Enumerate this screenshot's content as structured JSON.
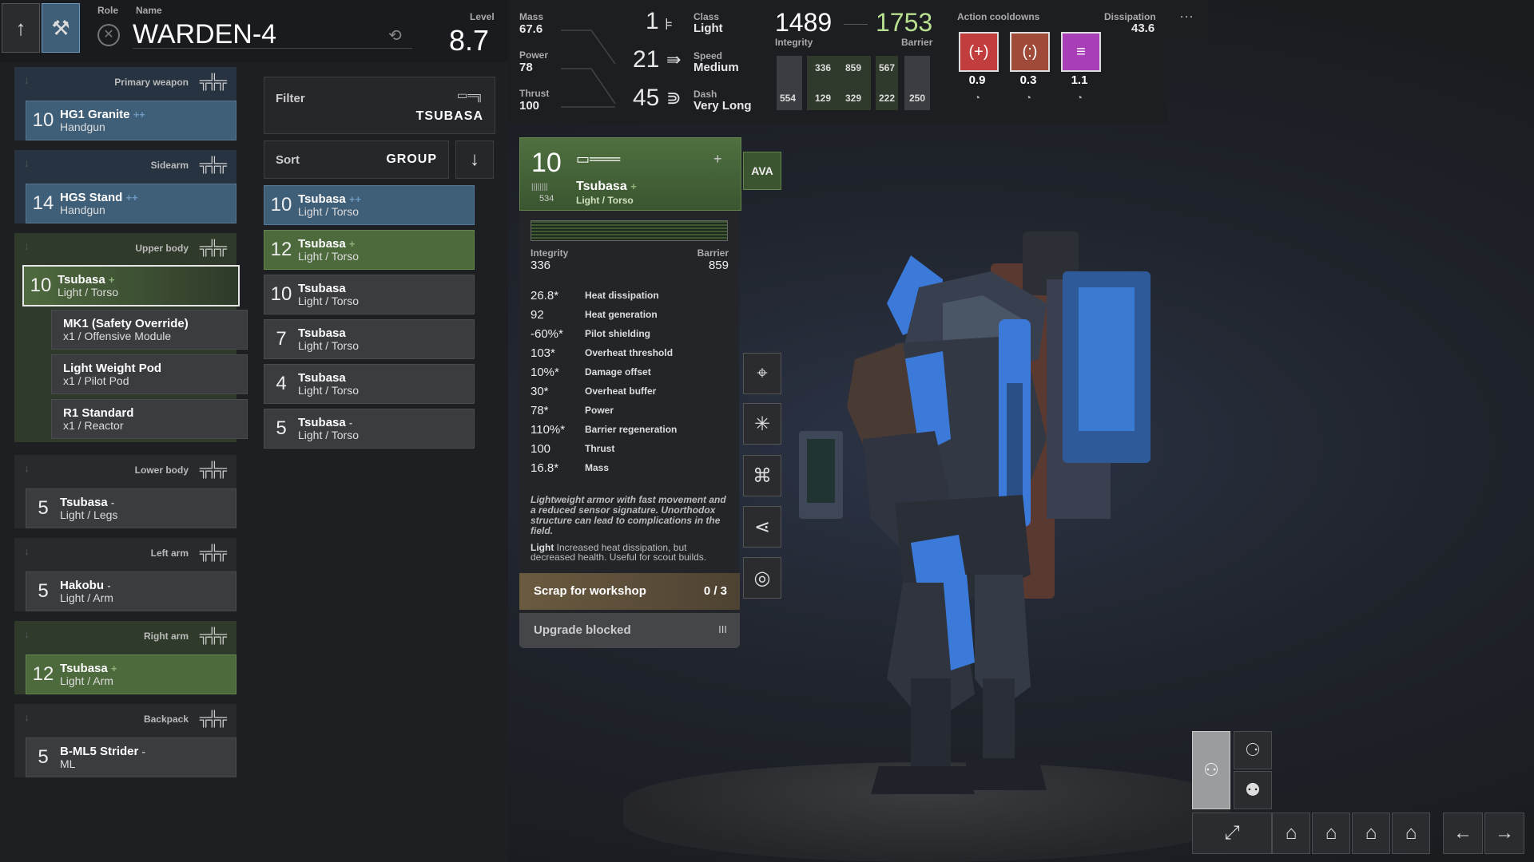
{
  "header": {
    "role_label": "Role",
    "name_label": "Name",
    "mech_name": "WARDEN-4",
    "level_label": "Level",
    "level": "8.7"
  },
  "top_stats": {
    "mass_label": "Mass",
    "mass": "67.6",
    "power_label": "Power",
    "power": "78",
    "thrust_label": "Thrust",
    "thrust": "100",
    "class_value": "1",
    "class_label": "Class",
    "class": "Light",
    "speed_value": "21",
    "speed_label": "Speed",
    "speed": "Medium",
    "dash_value": "45",
    "dash_label": "Dash",
    "dash": "Very Long",
    "integrity_total": "1489",
    "integrity_label": "Integrity",
    "barrier_total": "1753",
    "barrier_label": "Barrier",
    "bar_values": [
      "336",
      "859",
      "567",
      "554",
      "129",
      "329",
      "222",
      "250"
    ]
  },
  "cooldowns": {
    "label": "Action cooldowns",
    "items": [
      {
        "glyph": "(+)",
        "value": "0.9",
        "color": "#c23e3e"
      },
      {
        "glyph": "(:)",
        "value": "0.3",
        "color": "#a04a3a"
      },
      {
        "glyph": "≡",
        "value": "1.1",
        "color": "#a83fb6"
      }
    ],
    "dissipation_label": "Dissipation",
    "dissipation": "43.6",
    "more": "···"
  },
  "slots": [
    {
      "title": "Primary weapon",
      "level": "10",
      "name": "HG1 Granite",
      "mod": "++",
      "sub": "Handgun",
      "style": "blue"
    },
    {
      "title": "Sidearm",
      "level": "14",
      "name": "HGS Stand",
      "mod": "++",
      "sub": "Handgun",
      "style": "blue"
    },
    {
      "title": "Upper body",
      "level": "10",
      "name": "Tsubasa",
      "mod": "+",
      "sub": "Light / Torso",
      "style": "sel"
    },
    {
      "title": "Lower body",
      "level": "5",
      "name": "Tsubasa",
      "mod": "-",
      "sub": "Light / Legs",
      "style": "grey"
    },
    {
      "title": "Left arm",
      "level": "5",
      "name": "Hakobu",
      "mod": "-",
      "sub": "Light / Arm",
      "style": "grey"
    },
    {
      "title": "Right arm",
      "level": "12",
      "name": "Tsubasa",
      "mod": "+",
      "sub": "Light / Arm",
      "style": "green"
    },
    {
      "title": "Backpack",
      "level": "5",
      "name": "B-ML5 Strider",
      "mod": "-",
      "sub": "ML",
      "style": "grey"
    }
  ],
  "modules": [
    {
      "name": "MK1 (Safety Override)",
      "sub": "x1 / Offensive Module"
    },
    {
      "name": "Light Weight Pod",
      "sub": "x1 / Pilot Pod"
    },
    {
      "name": "R1 Standard",
      "sub": "x1 / Reactor"
    }
  ],
  "filter": {
    "label": "Filter",
    "value": "TSUBASA"
  },
  "sort": {
    "label": "Sort",
    "value": "GROUP"
  },
  "list": [
    {
      "level": "10",
      "name": "Tsubasa",
      "mod": "++",
      "sub": "Light / Torso",
      "style": "blue"
    },
    {
      "level": "12",
      "name": "Tsubasa",
      "mod": "+",
      "sub": "Light / Torso",
      "style": "green"
    },
    {
      "level": "10",
      "name": "Tsubasa",
      "mod": "",
      "sub": "Light / Torso",
      "style": "grey"
    },
    {
      "level": "7",
      "name": "Tsubasa",
      "mod": "",
      "sub": "Light / Torso",
      "style": "grey"
    },
    {
      "level": "4",
      "name": "Tsubasa",
      "mod": "",
      "sub": "Light / Torso",
      "style": "grey"
    },
    {
      "level": "5",
      "name": "Tsubasa",
      "mod": "-",
      "sub": "Light / Torso",
      "style": "grey"
    }
  ],
  "detail": {
    "level": "10",
    "name": "Tsubasa",
    "mod": "+",
    "sub": "Light / Torso",
    "code": "534",
    "badge": "AVA",
    "integrity_label": "Integrity",
    "integrity": "336",
    "barrier_label": "Barrier",
    "barrier": "859",
    "stats": [
      {
        "v": "26.8*",
        "n": "Heat dissipation"
      },
      {
        "v": "92",
        "n": "Heat generation"
      },
      {
        "v": "-60%*",
        "n": "Pilot shielding"
      },
      {
        "v": "103*",
        "n": "Overheat threshold"
      },
      {
        "v": "10%*",
        "n": "Damage offset"
      },
      {
        "v": "30*",
        "n": "Overheat buffer"
      },
      {
        "v": "78*",
        "n": "Power"
      },
      {
        "v": "110%*",
        "n": "Barrier regeneration"
      },
      {
        "v": "100",
        "n": "Thrust"
      },
      {
        "v": "16.8*",
        "n": "Mass"
      }
    ],
    "description": "Lightweight armor with fast movement and a reduced sensor signature. Unorthodox structure can lead to complications in the field.",
    "trait_name": "Light",
    "trait_text": "Increased heat dissipation, but decreased health. Useful for scout builds.",
    "scrap_label": "Scrap for workshop",
    "scrap_count": "0 / 3",
    "upgrade_label": "Upgrade blocked",
    "upgrade_icon": "III"
  }
}
